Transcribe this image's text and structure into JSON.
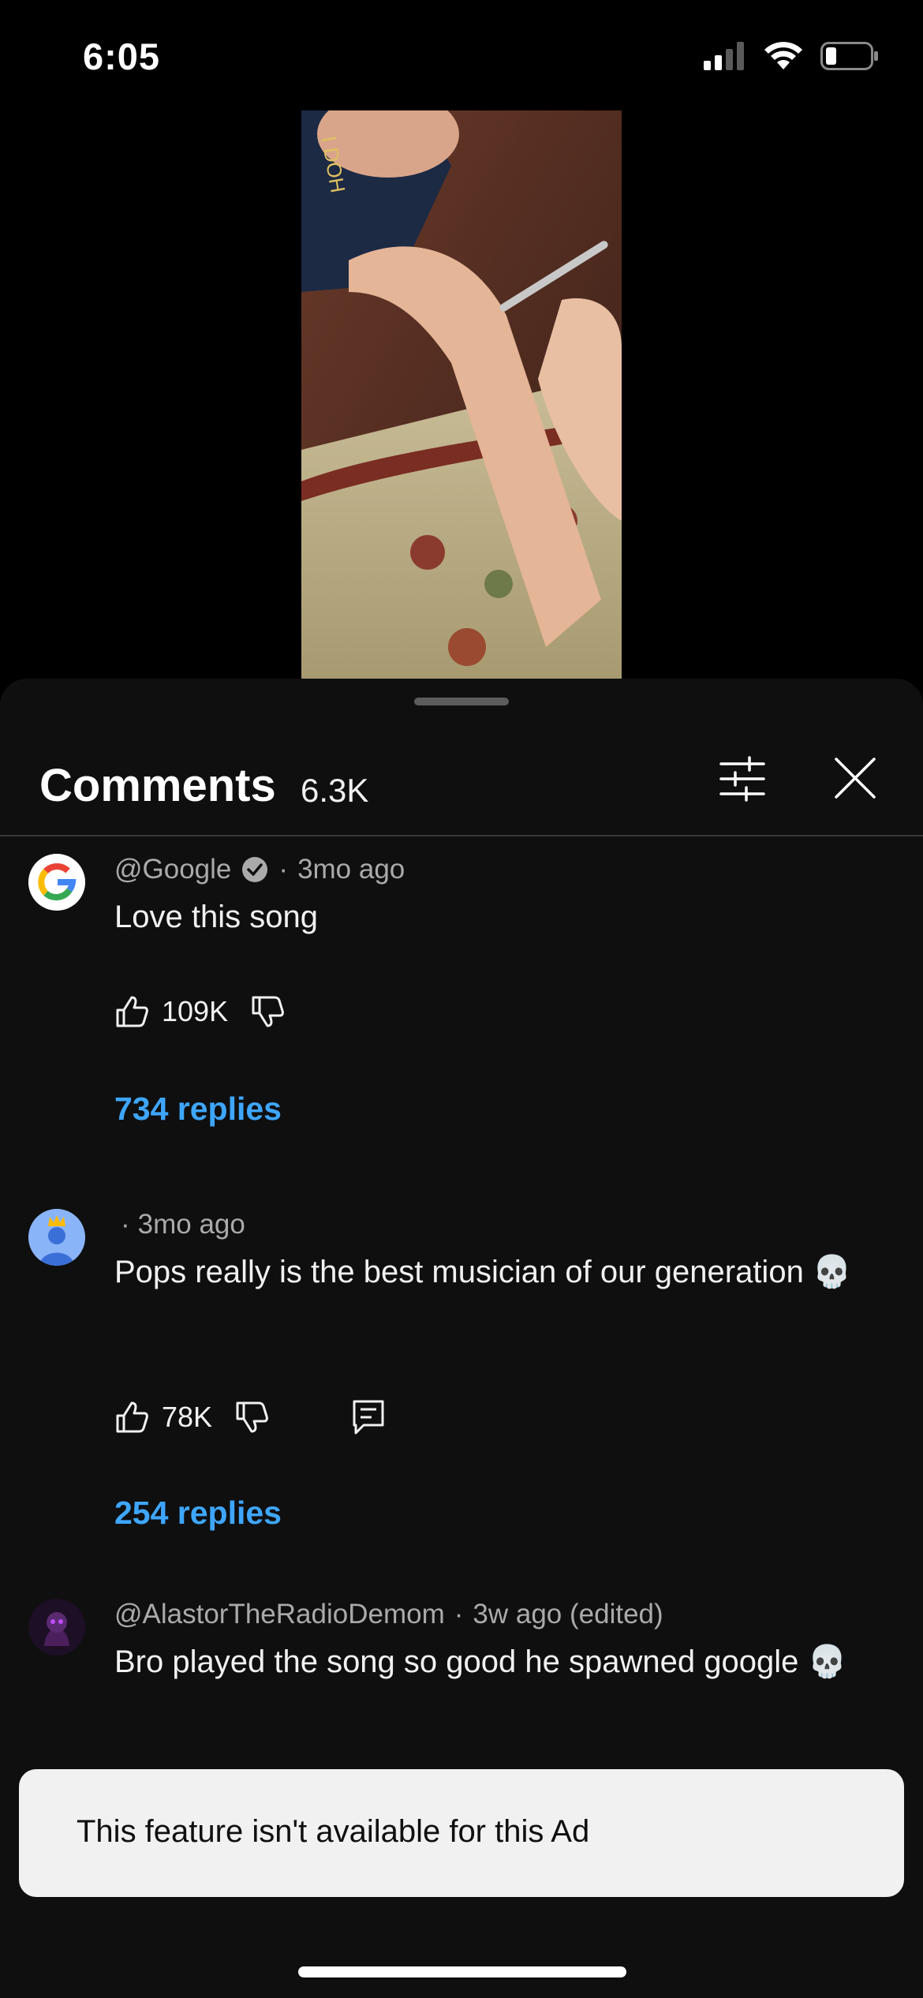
{
  "status": {
    "time": "6:05"
  },
  "comments_panel": {
    "title": "Comments",
    "count": "6.3K",
    "items": [
      {
        "author": "@Google",
        "verified": true,
        "age": "3mo ago",
        "text": "Love this song",
        "likes": "109K",
        "replies": "734 replies"
      },
      {
        "author": "",
        "age": "3mo ago",
        "text": "Pops really is the best musician of our generation 💀",
        "likes": "78K",
        "replies": "254 replies"
      },
      {
        "author": "@AlastorTheRadioDemom",
        "age": "3w ago (edited)",
        "text": "Bro played the song so good he spawned google 💀"
      }
    ]
  },
  "toast": {
    "message": "This feature isn't available for this Ad"
  },
  "colors": {
    "accent": "#3ea6ff",
    "background": "#0f0f0f",
    "toast": "#f1f1f1"
  }
}
